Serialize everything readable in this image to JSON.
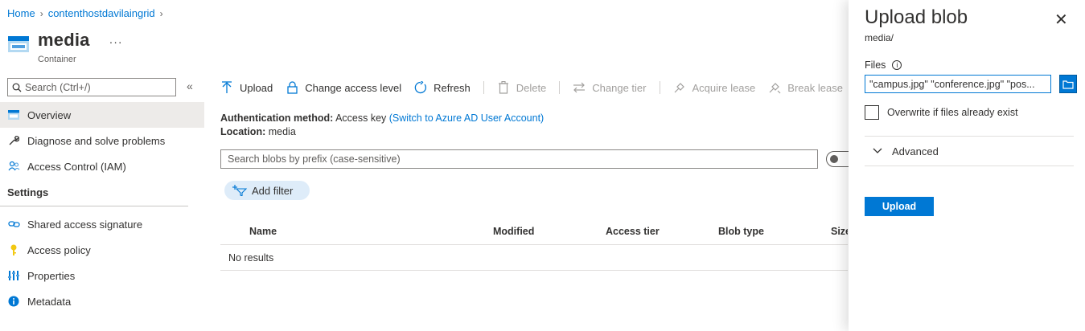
{
  "breadcrumb": {
    "home": "Home",
    "storage": "contenthostdavilaingrid"
  },
  "header": {
    "title": "media",
    "subtitle": "Container",
    "more": "···"
  },
  "sidebar": {
    "search_placeholder": "Search (Ctrl+/)",
    "collapse": "«",
    "items": [
      {
        "label": "Overview",
        "icon": "container-icon",
        "active": true
      },
      {
        "label": "Diagnose and solve problems",
        "icon": "wrench-icon"
      },
      {
        "label": "Access Control (IAM)",
        "icon": "people-icon"
      }
    ],
    "settings_header": "Settings",
    "settings_items": [
      {
        "label": "Shared access signature",
        "icon": "link-icon"
      },
      {
        "label": "Access policy",
        "icon": "key-icon"
      },
      {
        "label": "Properties",
        "icon": "properties-icon"
      },
      {
        "label": "Metadata",
        "icon": "info-icon"
      }
    ]
  },
  "toolbar": {
    "upload": "Upload",
    "change_access": "Change access level",
    "refresh": "Refresh",
    "delete": "Delete",
    "change_tier": "Change tier",
    "acquire_lease": "Acquire lease",
    "break_lease": "Break lease"
  },
  "info": {
    "auth_label": "Authentication method:",
    "auth_value": "Access key",
    "auth_link": "(Switch to Azure AD User Account)",
    "location_label": "Location:",
    "location_value": "media"
  },
  "blob_search_placeholder": "Search blobs by prefix (case-sensitive)",
  "add_filter": "Add filter",
  "table": {
    "columns": [
      "Name",
      "Modified",
      "Access tier",
      "Blob type",
      "Size"
    ],
    "empty": "No results"
  },
  "panel": {
    "title": "Upload blob",
    "path": "media/",
    "files_label": "Files",
    "files_value": "\"campus.jpg\" \"conference.jpg\" \"pos...",
    "overwrite_label": "Overwrite if files already exist",
    "advanced": "Advanced",
    "upload_button": "Upload",
    "close": "✕"
  },
  "colors": {
    "accent": "#0078d4",
    "nav_active": "#edebe9"
  }
}
